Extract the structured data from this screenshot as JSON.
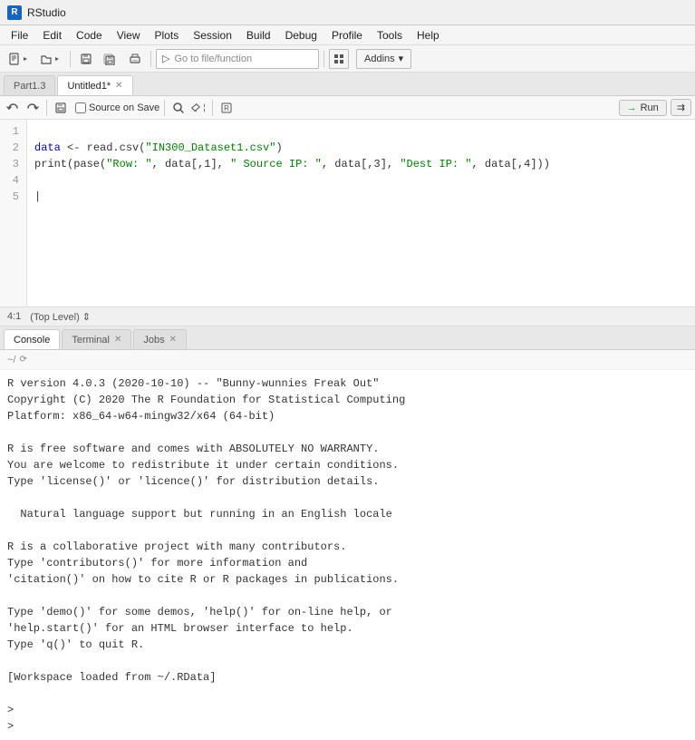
{
  "app": {
    "title": "RStudio",
    "icon_label": "R"
  },
  "menu": {
    "items": [
      "File",
      "Edit",
      "Code",
      "View",
      "Plots",
      "Session",
      "Build",
      "Debug",
      "Profile",
      "Tools",
      "Help"
    ]
  },
  "toolbar": {
    "goto_placeholder": "Go to file/function",
    "addins_label": "Addins"
  },
  "editor": {
    "tabs": [
      {
        "id": "part1",
        "label": "Part1.3",
        "active": false,
        "closable": false
      },
      {
        "id": "untitled1",
        "label": "Untitled1*",
        "active": true,
        "closable": true
      }
    ],
    "run_label": "Run",
    "source_on_save": "Source on Save",
    "lines": [
      {
        "num": 1,
        "content": "data <- read.csv(\"IN300_Dataset1.csv\")"
      },
      {
        "num": 2,
        "content": "print(pase(\"Row: \", data[,1], \" Source IP: \", data[,3], \"Dest IP: \", data[,4]))"
      },
      {
        "num": 3,
        "content": ""
      },
      {
        "num": 4,
        "content": ""
      },
      {
        "num": 5,
        "content": ""
      }
    ],
    "cursor_pos": "4:1",
    "scope": "Top Level"
  },
  "console": {
    "tabs": [
      {
        "id": "console",
        "label": "Console",
        "active": true,
        "closable": false
      },
      {
        "id": "terminal",
        "label": "Terminal",
        "active": false,
        "closable": true
      },
      {
        "id": "jobs",
        "label": "Jobs",
        "active": false,
        "closable": true
      }
    ],
    "path": "~/",
    "output": "R version 4.0.3 (2020-10-10) -- \"Bunny-wunnies Freak Out\"\nCopyright (C) 2020 The R Foundation for Statistical Computing\nPlatform: x86_64-w64-mingw32/x64 (64-bit)\n\nR is free software and comes with ABSOLUTELY NO WARRANTY.\nYou are welcome to redistribute it under certain conditions.\nType 'license()' or 'licence()' for distribution details.\n\n  Natural language support but running in an English locale\n\nR is a collaborative project with many contributors.\nType 'contributors()' for more information and\n'citation()' on how to cite R or R packages in publications.\n\nType 'demo()' for some demos, 'help()' for on-line help, or\n'help.start()' for an HTML browser interface to help.\nType 'q()' to quit R.\n\n[Workspace loaded from ~/.RData]\n\n>\n>"
  }
}
